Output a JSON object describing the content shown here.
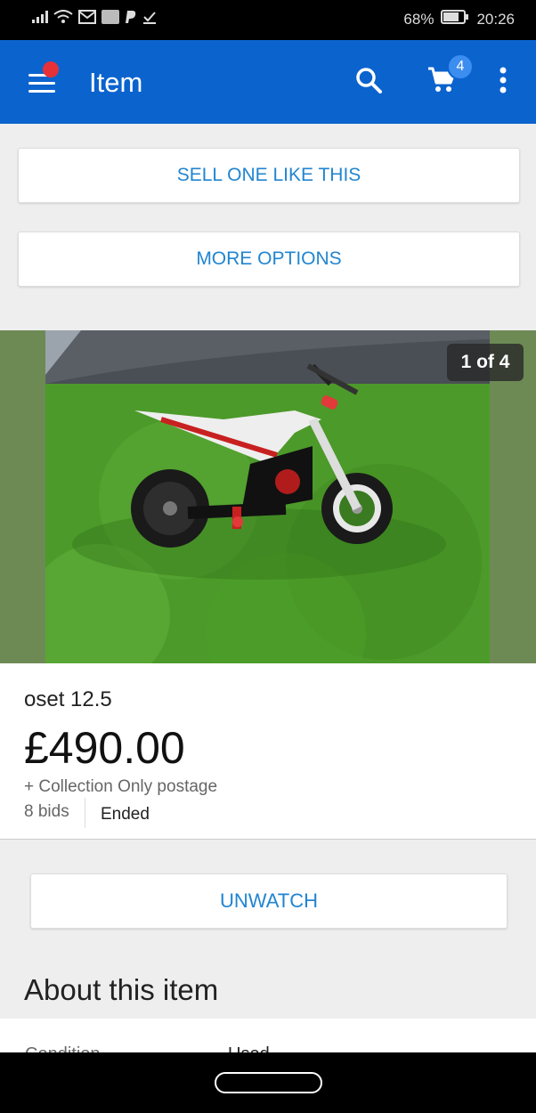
{
  "status_bar": {
    "battery_percent": "68%",
    "time": "20:26"
  },
  "app_bar": {
    "title": "Item",
    "cart_count": "4"
  },
  "actions": {
    "sell_one_like_this": "SELL ONE LIKE THIS",
    "more_options": "MORE OPTIONS"
  },
  "gallery": {
    "counter": "1 of 4"
  },
  "item": {
    "title": "oset 12.5",
    "price": "£490.00",
    "postage": "+ Collection Only postage",
    "bids": "8 bids",
    "status": "Ended"
  },
  "watch": {
    "unwatch_label": "UNWATCH"
  },
  "about": {
    "title": "About this item",
    "condition_label": "Condition",
    "condition_value": "Used"
  },
  "colors": {
    "brand_blue": "#0b63ce",
    "link_blue": "#2185d0",
    "notification_red": "#e53238"
  }
}
